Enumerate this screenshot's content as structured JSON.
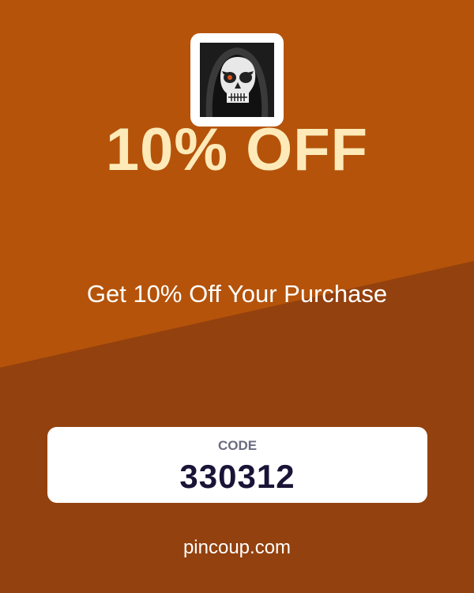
{
  "colors": {
    "background_top": "#b5530a",
    "background_bottom": "#93410e",
    "headline": "#fdeab8",
    "code_label": "#6b6b80",
    "code_value": "#1a1438",
    "card": "#ffffff"
  },
  "logo": {
    "icon": "grim-reaper-skull-icon"
  },
  "headline": "10% OFF",
  "subtitle": "Get 10% Off Your Purchase",
  "code": {
    "label": "CODE",
    "value": "330312"
  },
  "footer": "pincoup.com"
}
